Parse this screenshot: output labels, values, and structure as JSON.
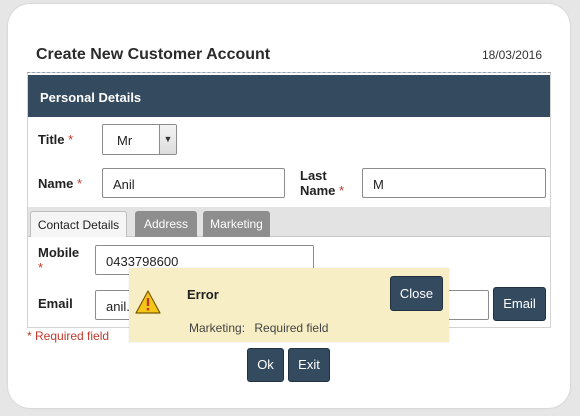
{
  "page": {
    "title": "Create New Customer Account",
    "date": "18/03/2016"
  },
  "section": {
    "title": "Personal Details"
  },
  "fields": {
    "title_label": "Title",
    "title_value": "Mr",
    "name_label": "Name",
    "name_value": "Anil",
    "last_name_label_1": "Last",
    "last_name_label_2": "Name",
    "last_name_value": "M",
    "mobile_label": "Mobile",
    "mobile_value": "0433798600",
    "email_label": "Email",
    "email_value": "anil.",
    "required_marker": "*"
  },
  "tabs": [
    {
      "label": "Contact Details",
      "active": true
    },
    {
      "label": "Address",
      "active": false
    },
    {
      "label": "Marketing",
      "active": false
    }
  ],
  "buttons": {
    "email": "Email",
    "ok": "Ok",
    "exit": "Exit"
  },
  "required_note": "* Required field",
  "error_popup": {
    "title": "Error",
    "field": "Marketing:",
    "message": "Required field",
    "close": "Close"
  },
  "colors": {
    "header_bg": "#344a5e",
    "required": "#c0392b",
    "popup_bg": "#f7eec5"
  }
}
